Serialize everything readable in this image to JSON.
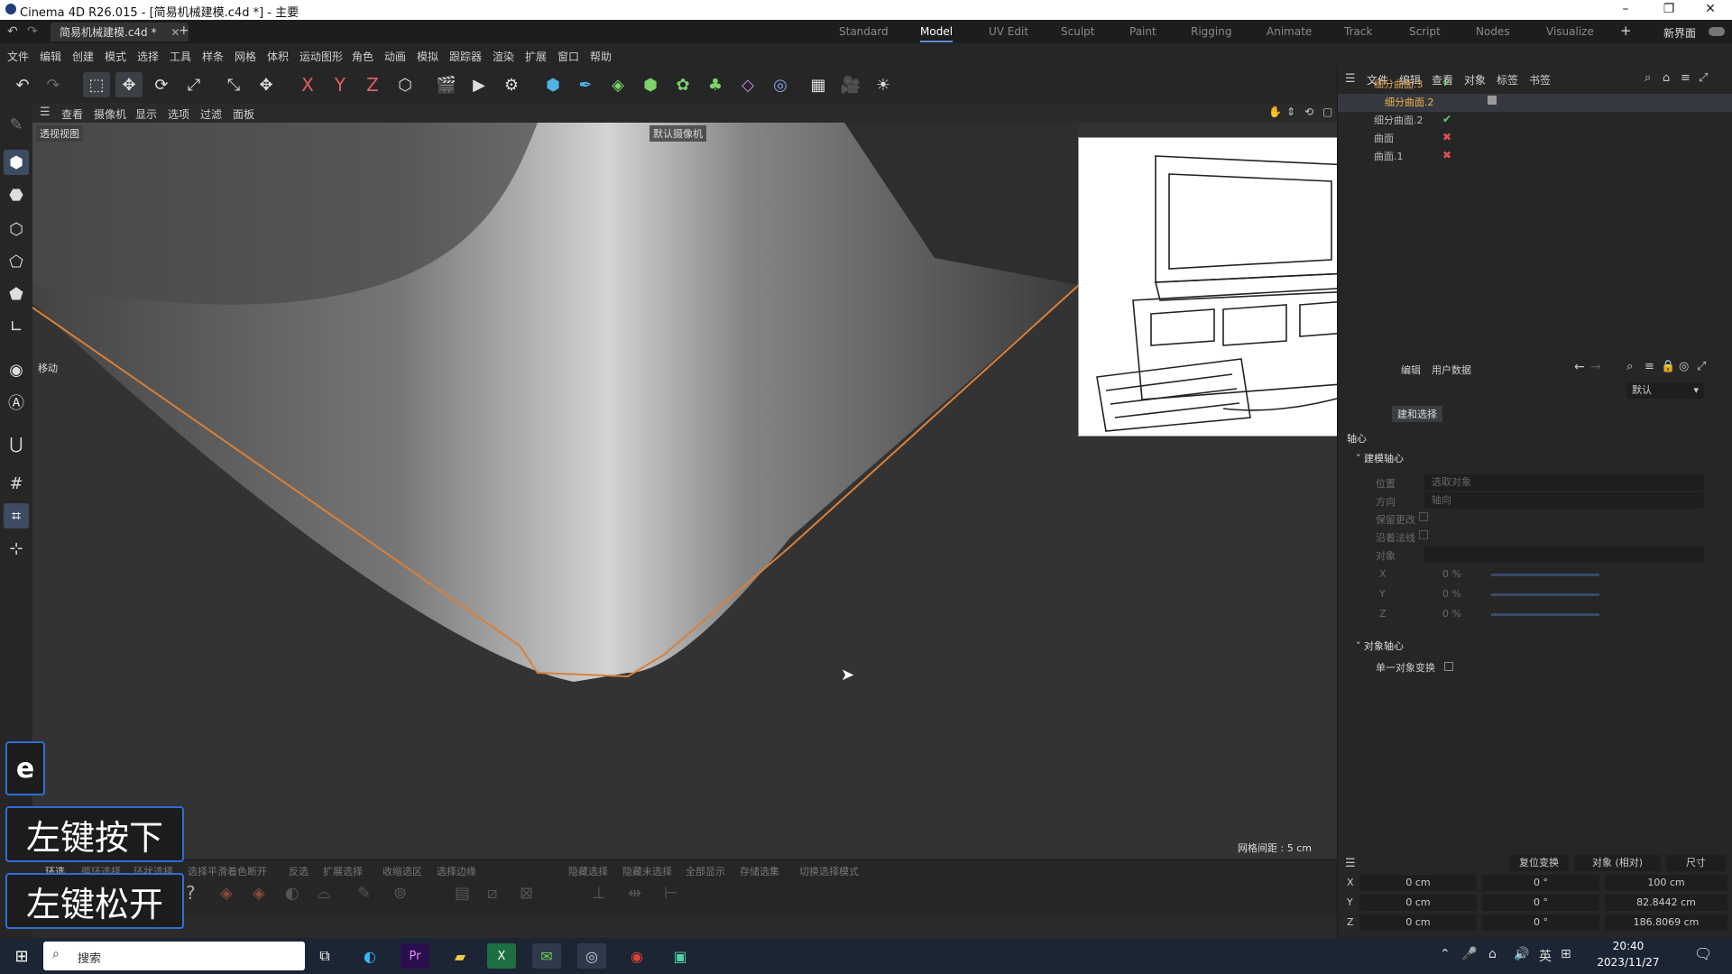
{
  "window": {
    "title": "Cinema 4D R26.015 - [简易机械建模.c4d *] - 主要",
    "minimize_icon": "–",
    "maximize_icon": "❐",
    "close_icon": "✕"
  },
  "doc_tab": {
    "label": "简易机械建模.c4d *",
    "close": "✕",
    "add": "+"
  },
  "layouts": [
    "Standard",
    "Model",
    "UV Edit",
    "Sculpt",
    "Paint",
    "Rigging",
    "Animate",
    "Track",
    "Script",
    "Nodes",
    "Visualize"
  ],
  "active_layout": "Model",
  "new_layout_label": "新界面",
  "menu": [
    "文件",
    "编辑",
    "创建",
    "模式",
    "选择",
    "工具",
    "样条",
    "网格",
    "体积",
    "运动图形",
    "角色",
    "动画",
    "模拟",
    "跟踪器",
    "渲染",
    "扩展",
    "窗口",
    "帮助"
  ],
  "axis_buttons": [
    "X",
    "Y",
    "Z"
  ],
  "viewport": {
    "menu": [
      "查看",
      "摄像机",
      "显示",
      "选项",
      "过滤",
      "面板"
    ],
    "view_label": "透视视图",
    "camera_label": "默认摄像机",
    "tool_label": "移动",
    "grid_spacing": "网格间距 : 5 cm"
  },
  "bottom_tools": [
    "环选",
    "循环选择",
    "环状选择",
    "选择平滑着色断开",
    "反选",
    "扩展选择",
    "收缩选区",
    "选择边缘",
    "隐藏选择",
    "隐藏未选择",
    "全部显示",
    "存储选集",
    "切换选择模式"
  ],
  "object_manager": {
    "menu": [
      "文件",
      "编辑",
      "查看",
      "对象",
      "标签",
      "书签"
    ],
    "objects": [
      {
        "name": "细分曲面.3",
        "status": "check",
        "status_icon": "✔"
      },
      {
        "name": "细分曲面.2",
        "status": "none",
        "status_icon": ""
      },
      {
        "name": "细分曲面.2",
        "status": "check",
        "status_icon": "✔"
      },
      {
        "name": "曲面",
        "status": "x",
        "status_icon": "✖"
      },
      {
        "name": "曲面.1",
        "status": "x",
        "status_icon": "✖"
      }
    ]
  },
  "attributes": {
    "tabs": [
      "编辑",
      "用户数据"
    ],
    "preset": "默认",
    "section_button": "建和选择",
    "axis_label": "轴心",
    "group1": "建模轴心",
    "rows": [
      {
        "label": "位置",
        "value": "选取对象"
      },
      {
        "label": "方向",
        "value": "轴向"
      },
      {
        "label": "保留更改",
        "value": ""
      },
      {
        "label": "沿着法线",
        "value": ""
      },
      {
        "label": "对象",
        "value": ""
      }
    ],
    "xyz": [
      {
        "axis": "X",
        "value": "0 %"
      },
      {
        "axis": "Y",
        "value": "0 %"
      },
      {
        "axis": "Z",
        "value": "0 %"
      }
    ],
    "group2": "对象轴心",
    "single_object": "单一对象变换"
  },
  "coords": {
    "reset_label": "复位变换",
    "mode": "对象 (相对)",
    "size_mode": "尺寸",
    "rows": [
      {
        "axis": "X",
        "pos": "0 cm",
        "rot": "0 °",
        "size": "100 cm"
      },
      {
        "axis": "Y",
        "pos": "0 cm",
        "rot": "0 °",
        "size": "82.8442 cm"
      },
      {
        "axis": "Z",
        "pos": "0 cm",
        "rot": "0 °",
        "size": "186.8069 cm"
      }
    ]
  },
  "overlay": {
    "key": "e",
    "mouse_down": "左键按下",
    "mouse_up": "左键松开"
  },
  "taskbar": {
    "search": "搜索",
    "lang": "英",
    "time": "20:40",
    "date": "2023/11/27"
  },
  "icons": {
    "undo": "↶",
    "redo": "↷",
    "select": "⬚",
    "move": "✥",
    "rotate": "⟳",
    "scale": "⤢",
    "camera": "🎥",
    "render": "▶",
    "cube": "⬢",
    "light": "☀",
    "search": "⌕",
    "windows": "⊞"
  }
}
